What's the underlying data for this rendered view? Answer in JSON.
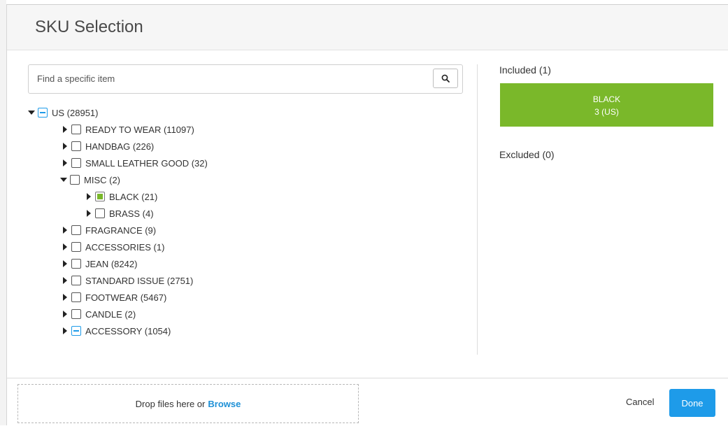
{
  "dialog": {
    "title": "SKU Selection"
  },
  "search": {
    "placeholder": "Find a specific item",
    "value": ""
  },
  "tree": [
    {
      "label": "US (28951)",
      "expanded": true,
      "checkbox": "partial",
      "children": [
        {
          "label": "READY TO WEAR (11097)",
          "expanded": false,
          "checkbox": "unchecked"
        },
        {
          "label": "HANDBAG (226)",
          "expanded": false,
          "checkbox": "unchecked"
        },
        {
          "label": "SMALL LEATHER GOOD (32)",
          "expanded": false,
          "checkbox": "unchecked"
        },
        {
          "label": "MISC (2)",
          "expanded": true,
          "checkbox": "unchecked",
          "children": [
            {
              "label": "BLACK (21)",
              "expanded": false,
              "checkbox": "checked"
            },
            {
              "label": "BRASS (4)",
              "expanded": false,
              "checkbox": "unchecked"
            }
          ]
        },
        {
          "label": "FRAGRANCE (9)",
          "expanded": false,
          "checkbox": "unchecked"
        },
        {
          "label": "ACCESSORIES (1)",
          "expanded": false,
          "checkbox": "unchecked"
        },
        {
          "label": "JEAN (8242)",
          "expanded": false,
          "checkbox": "unchecked"
        },
        {
          "label": "STANDARD ISSUE (2751)",
          "expanded": false,
          "checkbox": "unchecked"
        },
        {
          "label": "FOOTWEAR (5467)",
          "expanded": false,
          "checkbox": "unchecked"
        },
        {
          "label": "CANDLE (2)",
          "expanded": false,
          "checkbox": "unchecked"
        },
        {
          "label": "ACCESSORY (1054)",
          "expanded": false,
          "checkbox": "partial"
        }
      ]
    }
  ],
  "included": {
    "label": "Included (1)",
    "items": [
      {
        "name": "BLACK",
        "detail": "3 (US)"
      }
    ]
  },
  "excluded": {
    "label": "Excluded (0)"
  },
  "footer": {
    "drop_text": "Drop files here or",
    "browse_label": "Browse",
    "cancel_label": "Cancel",
    "done_label": "Done"
  },
  "colors": {
    "accent_blue": "#1e9be9",
    "included_green": "#7ab82a",
    "header_bg": "#f6f6f6"
  },
  "icons": {
    "search": "search-icon",
    "expand": "caret-right-icon",
    "collapse": "caret-down-icon"
  }
}
